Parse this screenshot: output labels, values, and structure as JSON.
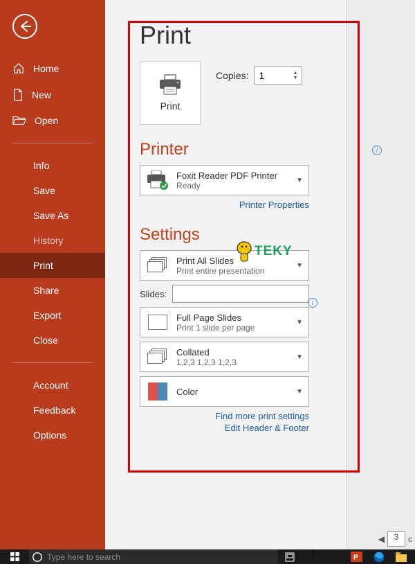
{
  "sidebar": {
    "home": "Home",
    "new": "New",
    "open": "Open",
    "items": [
      {
        "label": "Info"
      },
      {
        "label": "Save"
      },
      {
        "label": "Save As"
      },
      {
        "label": "History"
      },
      {
        "label": "Print"
      },
      {
        "label": "Share"
      },
      {
        "label": "Export"
      },
      {
        "label": "Close"
      }
    ],
    "bottom": [
      {
        "label": "Account"
      },
      {
        "label": "Feedback"
      },
      {
        "label": "Options"
      }
    ]
  },
  "page": {
    "title": "Print",
    "print_button": "Print",
    "copies_label": "Copies:",
    "copies_value": "1",
    "printer_heading": "Printer",
    "printer": {
      "name": "Foxit Reader PDF Printer",
      "status": "Ready"
    },
    "printer_props": "Printer Properties",
    "settings_heading": "Settings",
    "setting_range": {
      "title": "Print All Slides",
      "sub": "Print entire presentation"
    },
    "slides_label": "Slides:",
    "setting_layout": {
      "title": "Full Page Slides",
      "sub": "Print 1 slide per page"
    },
    "setting_collate": {
      "title": "Collated",
      "sub": "1,2,3    1,2,3    1,2,3"
    },
    "setting_color": {
      "title": "Color"
    },
    "more_settings": "Find more print settings",
    "edit_header_footer": "Edit Header & Footer",
    "page_current": "3",
    "page_of": "c"
  },
  "logo_text": "TEKY",
  "taskbar": {
    "search_placeholder": "Type here to search"
  }
}
